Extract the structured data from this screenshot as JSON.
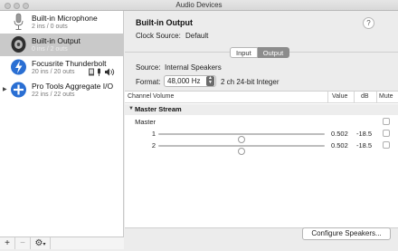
{
  "window": {
    "title": "Audio Devices"
  },
  "sidebar": {
    "devices": [
      {
        "name": "Built-in Microphone",
        "io": "2 ins / 0 outs",
        "icon": "microphone-icon"
      },
      {
        "name": "Built-in Output",
        "io": "0 ins / 2 outs",
        "icon": "speaker-icon",
        "selected": true
      },
      {
        "name": "Focusrite Thunderbolt",
        "io": "20 ins / 20 outs",
        "icon": "thunderbolt-icon"
      },
      {
        "name": "Pro Tools Aggregate I/O",
        "io": "22 ins / 22 outs",
        "icon": "aggregate-plus-icon"
      }
    ],
    "footer": {
      "add": "+",
      "remove": "−",
      "gear": "⚙"
    }
  },
  "detail": {
    "title": "Built-in Output",
    "help": "?",
    "clock_label": "Clock Source:",
    "clock_value": "Default",
    "tabs": [
      "Input",
      "Output"
    ],
    "active_tab": "Output",
    "source_label": "Source:",
    "source_value": "Internal Speakers",
    "format_label": "Format:",
    "format_value": "48,000 Hz",
    "format_desc": "2 ch 24-bit Integer",
    "table": {
      "headers": {
        "channel": "Channel Volume",
        "value": "Value",
        "db": "dB",
        "mute": "Mute"
      },
      "group": "Master Stream",
      "rows": [
        {
          "name": "Master",
          "value": "",
          "db": "",
          "level": null
        },
        {
          "name": "1",
          "value": "0.502",
          "db": "-18.5",
          "level": 0.502
        },
        {
          "name": "2",
          "value": "0.502",
          "db": "-18.5",
          "level": 0.502
        }
      ]
    },
    "configure_button": "Configure Speakers..."
  }
}
